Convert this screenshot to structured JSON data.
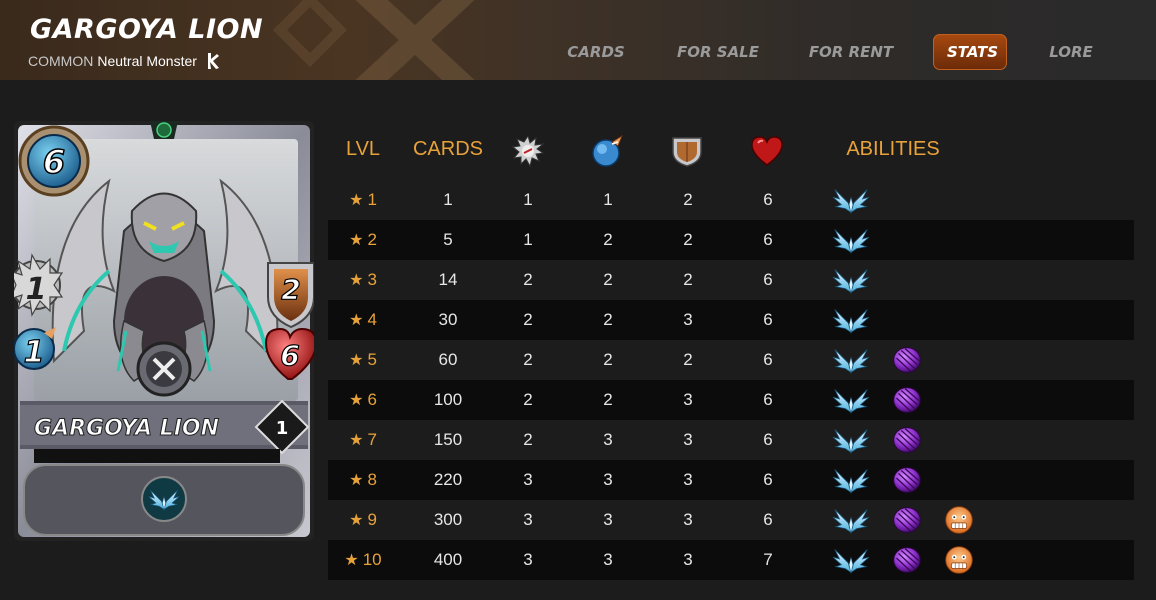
{
  "header": {
    "title": "GARGOYA LION",
    "rarity": "COMMON",
    "type_text": "Neutral Monster",
    "splinter_icon": "neutral-splinter-icon"
  },
  "nav": {
    "items": [
      {
        "label": "CARDS",
        "active": false
      },
      {
        "label": "FOR SALE",
        "active": false
      },
      {
        "label": "FOR RENT",
        "active": false
      },
      {
        "label": "STATS",
        "active": true
      },
      {
        "label": "LORE",
        "active": false
      }
    ]
  },
  "card": {
    "name": "GARGOYA LION",
    "mana": "6",
    "melee": "1",
    "speed": "1",
    "armor": "2",
    "health": "6",
    "level": "1",
    "ability_icon": "flying-icon",
    "attack_type_icon": "no-attack-icon"
  },
  "table": {
    "headers": {
      "lvl": "LVL",
      "cards": "CARDS",
      "attack_icon": "melee-attack-icon",
      "speed_icon": "speed-icon",
      "armor_icon": "armor-shield-icon",
      "health_icon": "health-heart-icon",
      "abilities": "ABILITIES"
    },
    "rows": [
      {
        "lvl": "1",
        "cards": "1",
        "attack": "1",
        "speed": "1",
        "armor": "2",
        "health": "6",
        "abilities": [
          "flying"
        ]
      },
      {
        "lvl": "2",
        "cards": "5",
        "attack": "1",
        "speed": "2",
        "armor": "2",
        "health": "6",
        "abilities": [
          "flying"
        ]
      },
      {
        "lvl": "3",
        "cards": "14",
        "attack": "2",
        "speed": "2",
        "armor": "2",
        "health": "6",
        "abilities": [
          "flying"
        ]
      },
      {
        "lvl": "4",
        "cards": "30",
        "attack": "2",
        "speed": "2",
        "armor": "3",
        "health": "6",
        "abilities": [
          "flying"
        ]
      },
      {
        "lvl": "5",
        "cards": "60",
        "attack": "2",
        "speed": "2",
        "armor": "2",
        "health": "6",
        "abilities": [
          "flying",
          "void"
        ]
      },
      {
        "lvl": "6",
        "cards": "100",
        "attack": "2",
        "speed": "2",
        "armor": "3",
        "health": "6",
        "abilities": [
          "flying",
          "void"
        ]
      },
      {
        "lvl": "7",
        "cards": "150",
        "attack": "2",
        "speed": "3",
        "armor": "3",
        "health": "6",
        "abilities": [
          "flying",
          "void"
        ]
      },
      {
        "lvl": "8",
        "cards": "220",
        "attack": "3",
        "speed": "3",
        "armor": "3",
        "health": "6",
        "abilities": [
          "flying",
          "void"
        ]
      },
      {
        "lvl": "9",
        "cards": "300",
        "attack": "3",
        "speed": "3",
        "armor": "3",
        "health": "6",
        "abilities": [
          "flying",
          "void",
          "taunt"
        ]
      },
      {
        "lvl": "10",
        "cards": "400",
        "attack": "3",
        "speed": "3",
        "armor": "3",
        "health": "7",
        "abilities": [
          "flying",
          "void",
          "taunt"
        ]
      }
    ]
  },
  "colors": {
    "accent_orange": "#e8a23a",
    "nav_active": "#8a3a0c",
    "row_dark": "#0c0c0c",
    "background": "#1c1c1c"
  }
}
